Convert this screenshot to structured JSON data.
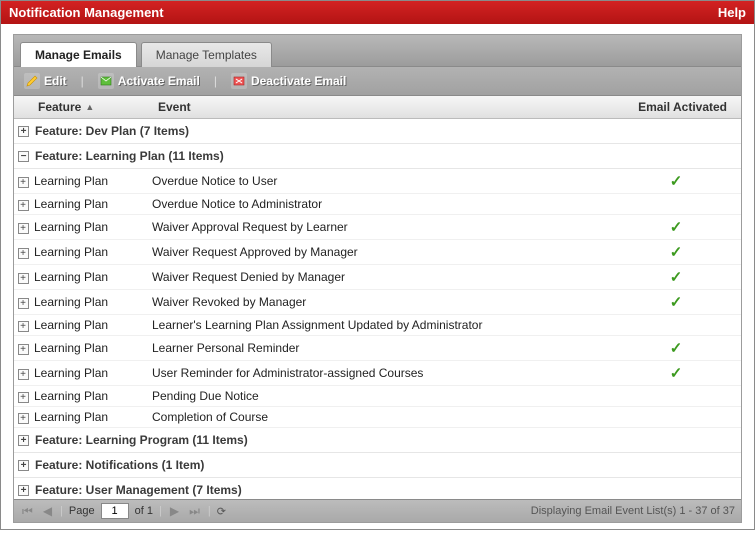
{
  "titlebar": {
    "title": "Notification Management",
    "help": "Help"
  },
  "tabs": {
    "manage_emails": "Manage Emails",
    "manage_templates": "Manage Templates"
  },
  "toolbar": {
    "edit": "Edit",
    "activate": "Activate Email",
    "deactivate": "Deactivate Email"
  },
  "columns": {
    "feature": "Feature",
    "event": "Event",
    "activated": "Email Activated"
  },
  "groups": {
    "dev_plan": "Feature: Dev Plan (7 Items)",
    "learning_plan": "Feature: Learning Plan (11 Items)",
    "learning_program": "Feature: Learning Program (11 Items)",
    "notifications": "Feature: Notifications (1 Item)",
    "user_management": "Feature: User Management (7 Items)"
  },
  "rows": [
    {
      "feature": "Learning Plan",
      "event": "Overdue Notice to User",
      "activated": true
    },
    {
      "feature": "Learning Plan",
      "event": "Overdue Notice to Administrator",
      "activated": false
    },
    {
      "feature": "Learning Plan",
      "event": "Waiver Approval Request by Learner",
      "activated": true
    },
    {
      "feature": "Learning Plan",
      "event": "Waiver Request Approved by Manager",
      "activated": true
    },
    {
      "feature": "Learning Plan",
      "event": "Waiver Request Denied by Manager",
      "activated": true
    },
    {
      "feature": "Learning Plan",
      "event": "Waiver Revoked by Manager",
      "activated": true
    },
    {
      "feature": "Learning Plan",
      "event": "Learner's Learning Plan Assignment Updated by Administrator",
      "activated": false
    },
    {
      "feature": "Learning Plan",
      "event": "Learner Personal Reminder",
      "activated": true
    },
    {
      "feature": "Learning Plan",
      "event": "User Reminder for Administrator-assigned Courses",
      "activated": true
    },
    {
      "feature": "Learning Plan",
      "event": "Pending Due Notice",
      "activated": false
    },
    {
      "feature": "Learning Plan",
      "event": "Completion of Course",
      "activated": false
    }
  ],
  "pager": {
    "page_label": "Page",
    "current": "1",
    "of_label": "of 1",
    "status": "Displaying Email Event List(s) 1 - 37 of 37"
  }
}
